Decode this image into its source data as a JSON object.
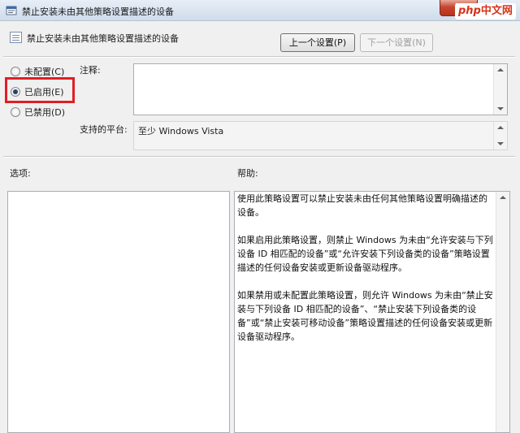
{
  "window": {
    "title": "禁止安装未由其他策略设置描述的设备",
    "close_label": "✕",
    "brand_php": "php",
    "brand_cn": "中文网"
  },
  "header": {
    "title": "禁止安装未由其他策略设置描述的设备",
    "prev_button": "上一个设置(P)",
    "next_button": "下一个设置(N)"
  },
  "state": {
    "options": [
      {
        "label": "未配置(C)",
        "checked": false
      },
      {
        "label": "已启用(E)",
        "checked": true
      },
      {
        "label": "已禁用(D)",
        "checked": false
      }
    ]
  },
  "comment": {
    "label": "注释:",
    "value": ""
  },
  "platform": {
    "label": "支持的平台:",
    "value": "至少 Windows Vista"
  },
  "options_section": {
    "label": "选项:"
  },
  "help_section": {
    "label": "帮助:",
    "paragraphs": [
      "使用此策略设置可以禁止安装未由任何其他策略设置明确描述的设备。",
      "如果启用此策略设置，则禁止 Windows 为未由“允许安装与下列设备 ID 相匹配的设备”或“允许安装下列设备类的设备”策略设置描述的任何设备安装或更新设备驱动程序。",
      "如果禁用或未配置此策略设置，则允许 Windows 为未由“禁止安装与下列设备 ID 相匹配的设备”、“禁止安装下列设备类的设备”或“禁止安装可移动设备”策略设置描述的任何设备安装或更新设备驱动程序。"
    ]
  },
  "accent": {
    "highlight_color": "#e01e25"
  }
}
